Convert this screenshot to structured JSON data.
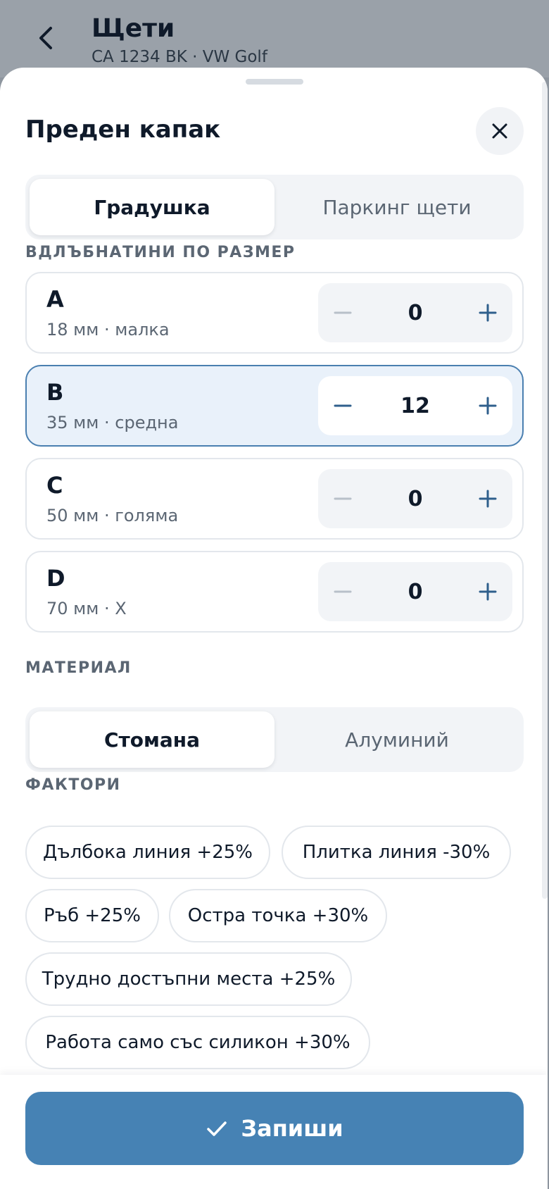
{
  "header": {
    "title": "Щети",
    "subtitle": "CA 1234 BK · VW Golf"
  },
  "sheet": {
    "title": "Преден капак",
    "close_icon": "close-icon"
  },
  "damage_type_tabs": [
    {
      "label": "Градушка",
      "active": true
    },
    {
      "label": "Паркинг щети",
      "active": false
    }
  ],
  "dents_section": {
    "label": "ВДЛЪБНАТИНИ ПО РАЗМЕР",
    "rows": [
      {
        "letter": "A",
        "desc": "18 мм · малка",
        "count": "0",
        "selected": false
      },
      {
        "letter": "B",
        "desc": "35 мм · средна",
        "count": "12",
        "selected": true
      },
      {
        "letter": "C",
        "desc": "50 мм · голяма",
        "count": "0",
        "selected": false
      },
      {
        "letter": "D",
        "desc": "70 мм · X",
        "count": "0",
        "selected": false
      }
    ]
  },
  "material_section": {
    "label": "МАТЕРИАЛ",
    "options": [
      {
        "label": "Стомана",
        "active": true
      },
      {
        "label": "Алуминий",
        "active": false
      }
    ]
  },
  "factors_section": {
    "label": "ФАКТОРИ",
    "chips": [
      "Дълбока линия +25%",
      "Плитка линия -30%",
      "Ръб +25%",
      "Остра точка +30%",
      "Трудно достъпни места +25%",
      "Работа само със силикон +30%"
    ]
  },
  "footer": {
    "save_label": "Запиши"
  },
  "colors": {
    "accent": "#4682b4",
    "selected_bg": "#e9f1fa",
    "selected_border": "#4a7fb0",
    "text_primary": "#0f1a2a",
    "text_secondary": "#5b6673"
  }
}
